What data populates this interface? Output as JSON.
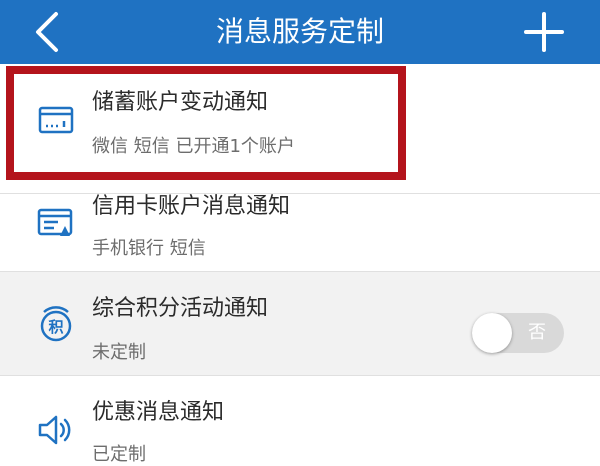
{
  "header": {
    "title": "消息服务定制",
    "back_icon": "chevron-left-icon",
    "add_icon": "plus-icon",
    "background": "#1f72c2"
  },
  "items": [
    {
      "title": "储蓄账户变动通知",
      "subtitle": "微信 短信 已开通1个账户",
      "icon": "savings-card-icon",
      "highlighted": true
    },
    {
      "title": "信用卡账户消息通知",
      "subtitle": "手机银行 短信",
      "icon": "credit-card-statement-icon"
    },
    {
      "title": "综合积分活动通知",
      "subtitle": "未定制",
      "icon": "points-icon",
      "toggle": {
        "label": "否",
        "on": false
      }
    },
    {
      "title": "优惠消息通知",
      "subtitle": "已定制",
      "icon": "speaker-icon"
    }
  ],
  "colors": {
    "accent": "#1f72c2",
    "highlight_border": "#b4141c"
  }
}
